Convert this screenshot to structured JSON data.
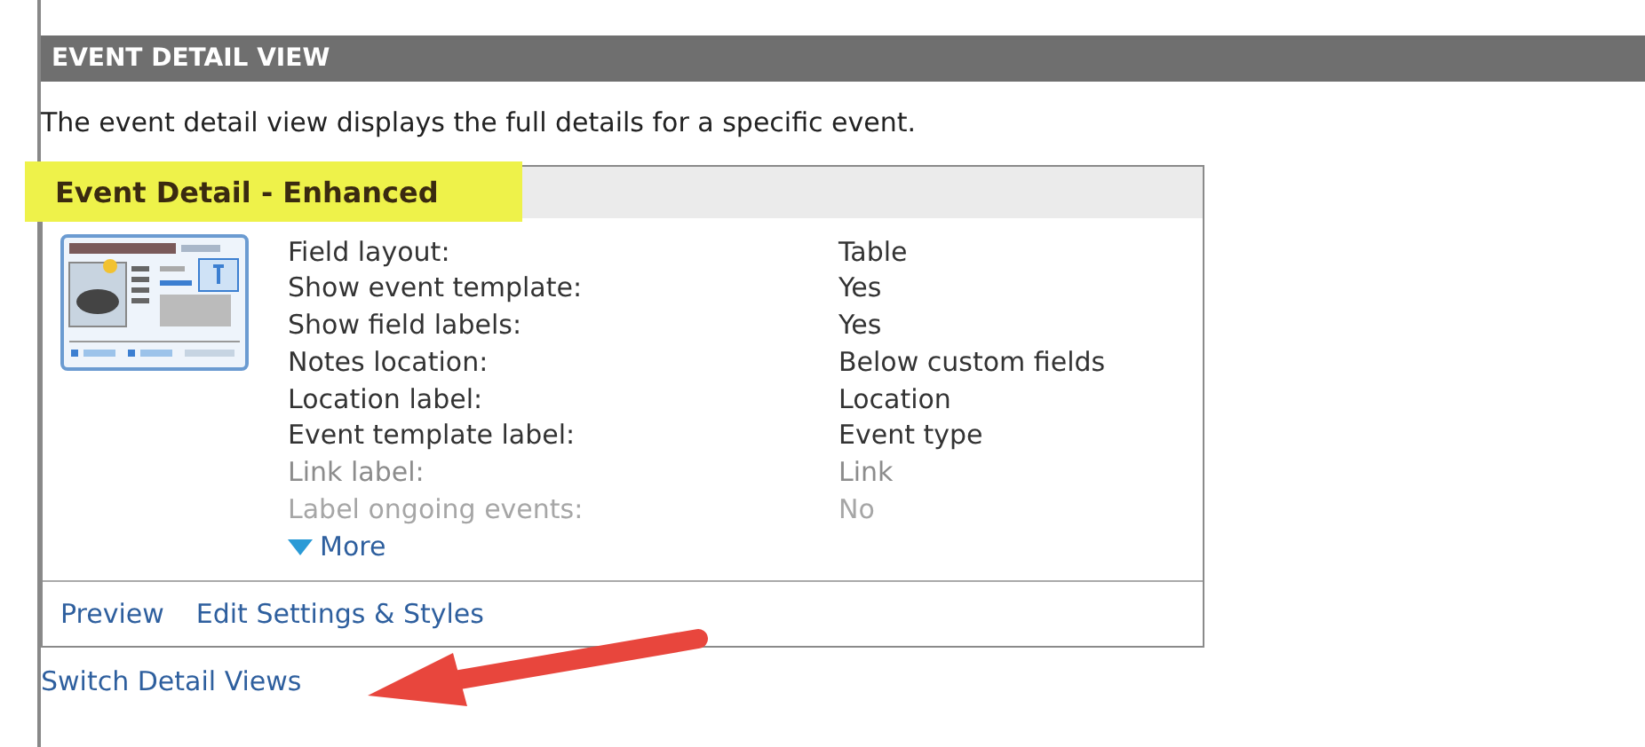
{
  "section": {
    "title": "EVENT DETAIL VIEW",
    "description": "The event detail view displays the full details for a specific event."
  },
  "card": {
    "title": "Event Detail - Enhanced",
    "title_highlighted": true,
    "fields": [
      {
        "label": "Field layout:",
        "value": "Table",
        "kind": "normal"
      },
      {
        "label": "Show event template:",
        "value": "Yes",
        "kind": "normal"
      },
      {
        "label": "Show field labels:",
        "value": "Yes",
        "kind": "normal"
      },
      {
        "label": "Notes location:",
        "value": "Below custom fields",
        "kind": "normal"
      },
      {
        "label": "Location label:",
        "value": "Location",
        "kind": "normal"
      },
      {
        "label": "Event template label:",
        "value": "Event type",
        "kind": "normal"
      },
      {
        "label": "Link label:",
        "value": "Link",
        "kind": "faded"
      },
      {
        "label": "Label ongoing events:",
        "value": "No",
        "kind": "faint"
      }
    ],
    "more": "More",
    "footer_links": [
      "Preview",
      "Edit Settings & Styles"
    ]
  },
  "switch_link": "Switch Detail Views",
  "pointer_arrow": true
}
